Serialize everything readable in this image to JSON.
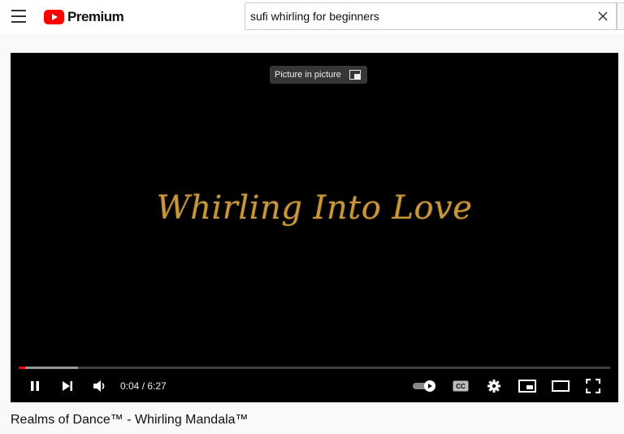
{
  "app": {
    "brand": "Premium"
  },
  "search": {
    "query": "sufi whirling for beginners"
  },
  "player": {
    "tooltip": "Picture in picture",
    "title_text": "Whirling Into Love",
    "current_time": "0:04",
    "duration": "6:27",
    "time_display": "0:04 / 6:27",
    "progress_played_fraction": 0.011,
    "progress_buffered_fraction": 0.1,
    "autoplay_on": true
  },
  "video": {
    "title": "Realms of Dance™ - Whirling Mandala™"
  },
  "colors": {
    "accent": "#ff0000",
    "title_gold": "#c8973c"
  },
  "icons": [
    "menu-icon",
    "youtube-logo-icon",
    "clear-icon",
    "pip-icon",
    "pause-icon",
    "next-icon",
    "volume-icon",
    "autoplay-toggle-icon",
    "cc-icon",
    "settings-icon",
    "miniplayer-icon",
    "theater-icon",
    "fullscreen-icon"
  ]
}
